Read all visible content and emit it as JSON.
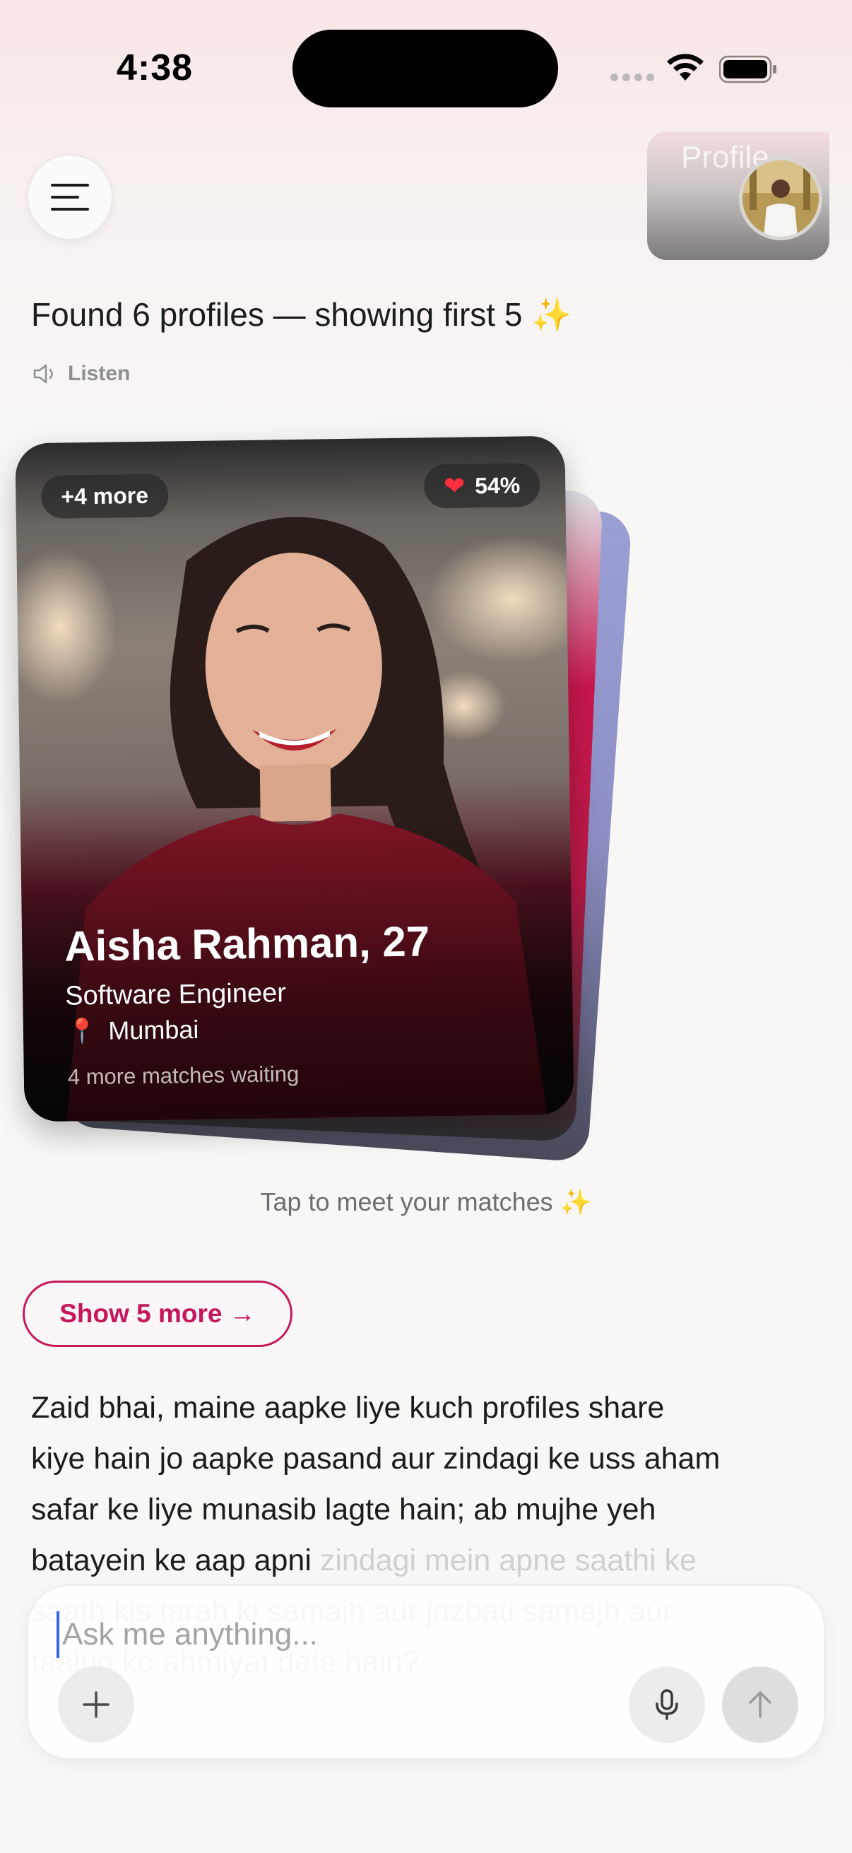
{
  "status": {
    "time": "4:38"
  },
  "header": {
    "profile_label": "Profile"
  },
  "chat": {
    "found_text": "Found 6 profiles — showing first 5",
    "listen_label": "Listen",
    "card": {
      "more_badge": "+4 more",
      "match_percent": "54%",
      "name_age": "Aisha Rahman, 27",
      "role": "Software Engineer",
      "location": "Mumbai",
      "waiting": "4 more matches waiting"
    },
    "tap_hint": "Tap to meet your matches",
    "show_more_label": "Show 5 more →",
    "message_visible": "Zaid bhai, maine aapke liye kuch profiles share kiye hain jo aapke pasand aur zindagi ke uss aham safar ke liye munasib lagte hain; ab mujhe yeh batayein ke aap apni",
    "message_faded": "zindagi mein apne saathi ke saath kis tarah ki samajh aur jazbati samajh aur taaluq ko ahmiyat dete hain?"
  },
  "composer": {
    "placeholder": "Ask me anything..."
  },
  "colors": {
    "accent": "#c6175a",
    "heart": "#ff2d40",
    "sparkle": "#f2c230"
  },
  "icons": {
    "menu": "hamburger-menu-icon",
    "listen": "speaker-icon",
    "match": "heart-icon",
    "location": "pin-icon",
    "sparkle": "sparkles-icon",
    "add": "plus-icon",
    "mic": "microphone-icon",
    "send": "arrow-up-icon"
  }
}
